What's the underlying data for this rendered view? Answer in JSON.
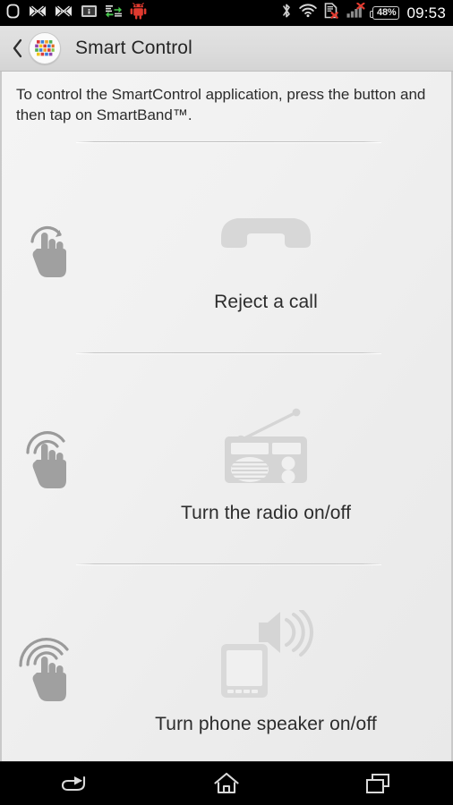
{
  "status_bar": {
    "left_icons": [
      {
        "name": "smartband-icon",
        "label": "SmartBand"
      },
      {
        "name": "sync-disabled-icon",
        "label": "Sync disabled"
      },
      {
        "name": "sync-disabled-2-icon",
        "label": "Sync disabled"
      },
      {
        "name": "info-icon",
        "label": "Info"
      },
      {
        "name": "data-transfer-icon",
        "label": "Data transfer"
      },
      {
        "name": "android-debug-icon",
        "label": "USB debugging"
      }
    ],
    "right_icons": [
      {
        "name": "bluetooth-icon",
        "label": "Bluetooth"
      },
      {
        "name": "wifi-icon",
        "label": "Wi-Fi"
      },
      {
        "name": "sim-card-missing-icon",
        "label": "No SIM card"
      },
      {
        "name": "cellular-signal-off-icon",
        "label": "No service"
      }
    ],
    "battery_percent": "48%",
    "clock": "09:53",
    "accent_red": "#e03a2f",
    "icon_gray": "#c8c8c8"
  },
  "header": {
    "back_icon": "chevron-left-icon",
    "app_icon": "smart-connect-icon",
    "title": "Smart Control"
  },
  "main": {
    "intro_text": "To control the SmartControl application, press the button and then tap on SmartBand™.",
    "items": [
      {
        "gesture_icon": "single-tap-hand-icon",
        "gesture_taps": 1,
        "art_icon": "phone-handset-icon",
        "label": "Reject a call"
      },
      {
        "gesture_icon": "double-tap-hand-icon",
        "gesture_taps": 2,
        "art_icon": "radio-icon",
        "label": "Turn the radio on/off"
      },
      {
        "gesture_icon": "triple-tap-hand-icon",
        "gesture_taps": 3,
        "art_icon": "phone-speaker-icon",
        "label": "Turn phone speaker on/off"
      }
    ],
    "art_color": "#d5d5d5",
    "gesture_color": "#9a9a9a",
    "text_color": "#2c2c2c"
  },
  "nav_bar": {
    "buttons": [
      {
        "name": "nav-back-button",
        "label": "Back"
      },
      {
        "name": "nav-home-button",
        "label": "Home"
      },
      {
        "name": "nav-recents-button",
        "label": "Recent apps"
      }
    ]
  }
}
